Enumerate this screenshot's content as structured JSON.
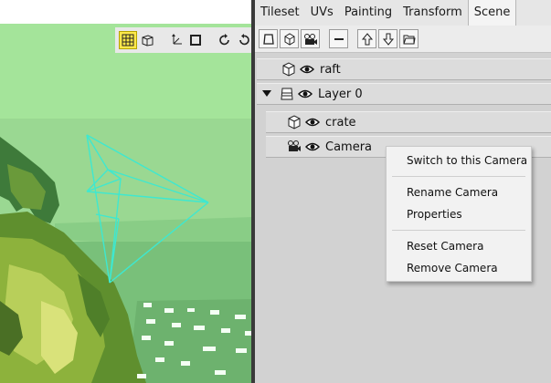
{
  "tabs": [
    "Tileset",
    "UVs",
    "Painting",
    "Transform",
    "Scene"
  ],
  "active_tab": "Scene",
  "viewport_toolbar": {
    "icons": [
      "grid-icon",
      "box-view-icon",
      "move-axes-icon",
      "select-square-icon",
      "rotate-ccw-icon",
      "rotate-cw-icon"
    ],
    "active": "grid-icon"
  },
  "scene_toolbar": {
    "icons": [
      "new-layer-icon",
      "add-object-icon",
      "add-camera-icon",
      "remove-icon",
      "move-up-icon",
      "move-down-icon",
      "open-folder-icon"
    ]
  },
  "tree": {
    "items": [
      {
        "label": "raft",
        "type": "object"
      },
      {
        "label": "Layer 0",
        "type": "layer",
        "expanded": true
      },
      {
        "label": "crate",
        "type": "object"
      },
      {
        "label": "Camera",
        "type": "camera"
      }
    ]
  },
  "context_menu": {
    "items": [
      "Switch to this Camera",
      "Rename Camera",
      "Properties",
      "Reset Camera",
      "Remove Camera"
    ]
  },
  "colors": {
    "sky": "#a4e49a",
    "camera_wire": "#3ee8d0",
    "active_tool": "#ffe84a"
  }
}
